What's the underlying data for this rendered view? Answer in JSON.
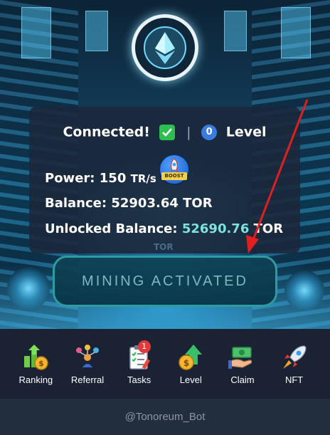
{
  "status": {
    "connected_text": "Connected!",
    "separator": "|",
    "level_number": "0",
    "level_text": "Level"
  },
  "power": {
    "label": "Power:",
    "value": "150",
    "unit": "TR/s"
  },
  "boost_label": "BOOST",
  "balance": {
    "label": "Balance:",
    "value": "52903.64 TOR"
  },
  "unlocked": {
    "label": "Unlocked Balance:",
    "value": "52690.76",
    "unit": "TOR"
  },
  "watermark": "TOR",
  "mining_button": "MINING ACTIVATED",
  "nav": {
    "items": [
      {
        "label": "Ranking",
        "icon": "ranking-icon"
      },
      {
        "label": "Referral",
        "icon": "referral-icon"
      },
      {
        "label": "Tasks",
        "icon": "tasks-icon",
        "badge": "1"
      },
      {
        "label": "Level",
        "icon": "level-icon"
      },
      {
        "label": "Claim",
        "icon": "claim-icon"
      },
      {
        "label": "NFT",
        "icon": "nft-icon"
      }
    ]
  },
  "footer": "@Tonoreum_Bot",
  "colors": {
    "accent_teal": "#7de3df",
    "button_border": "#2e9aa2",
    "check_green": "#2cbf4f",
    "level_blue": "#3a7be0",
    "arrow_red": "#e02020"
  }
}
